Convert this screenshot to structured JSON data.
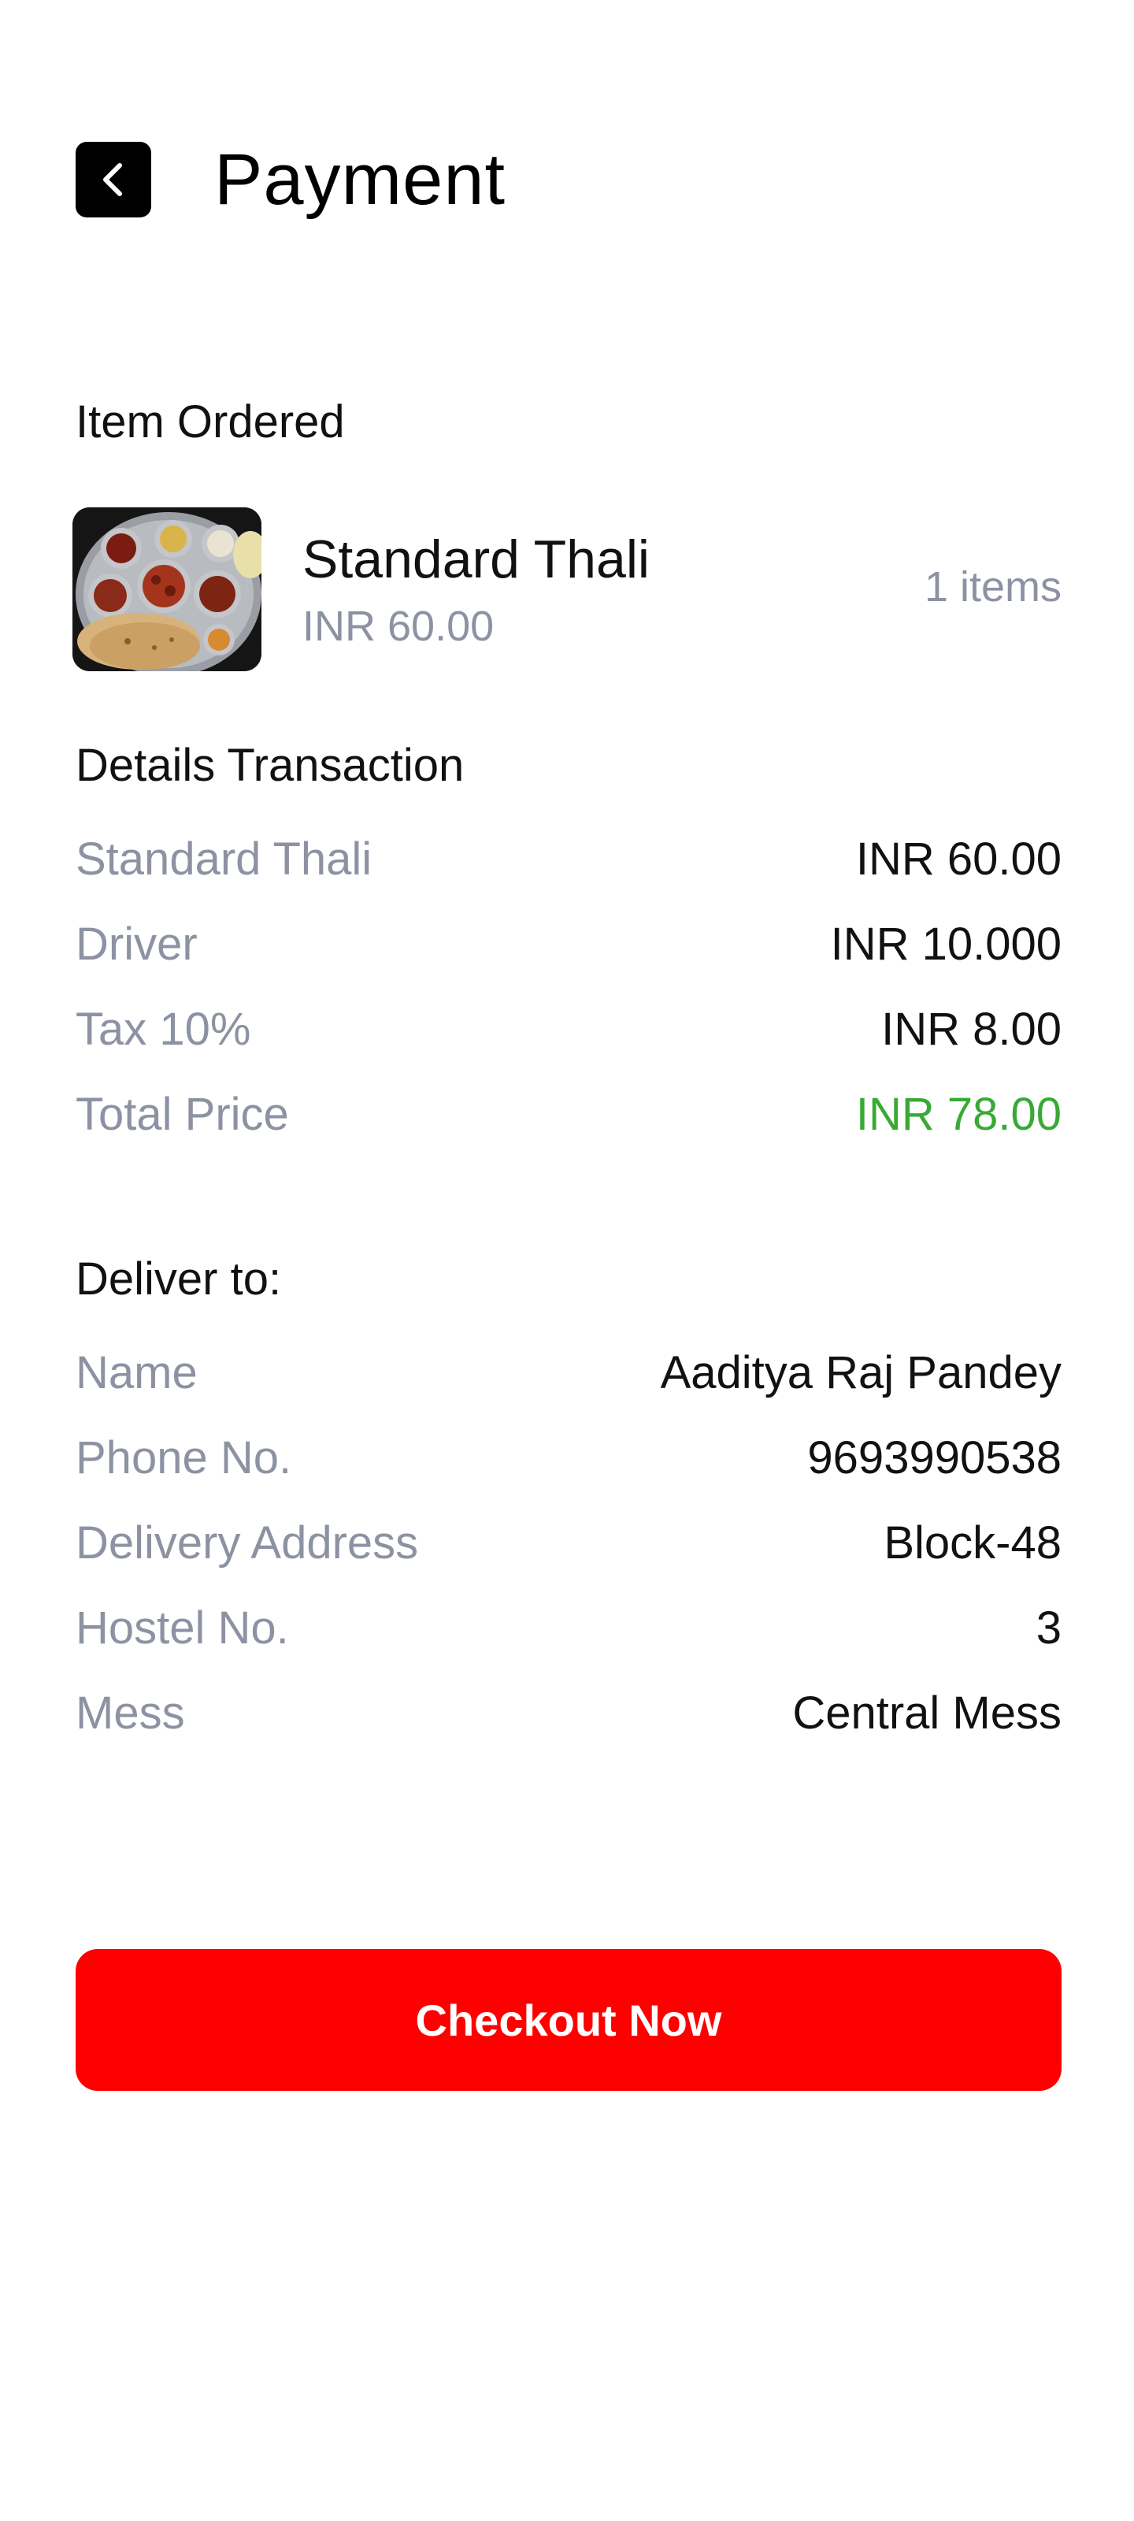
{
  "header": {
    "title": "Payment",
    "back_icon": "chevron-left-icon"
  },
  "item_ordered": {
    "heading": "Item Ordered",
    "name": "Standard Thali",
    "price": "INR 60.00",
    "quantity": "1 items",
    "image_icon": "thali-food-photo"
  },
  "transaction": {
    "heading": "Details Transaction",
    "rows": [
      {
        "label": "Standard Thali",
        "value": "INR 60.00"
      },
      {
        "label": "Driver",
        "value": "INR 10.000"
      },
      {
        "label": "Tax 10%",
        "value": "INR 8.00"
      },
      {
        "label": "Total Price",
        "value": "INR 78.00"
      }
    ]
  },
  "delivery": {
    "heading": "Deliver to:",
    "rows": [
      {
        "label": "Name",
        "value": "Aaditya Raj Pandey"
      },
      {
        "label": "Phone No.",
        "value": "9693990538"
      },
      {
        "label": "Delivery Address",
        "value": "Block-48"
      },
      {
        "label": "Hostel No.",
        "value": "3"
      },
      {
        "label": "Mess",
        "value": "Central Mess"
      }
    ]
  },
  "checkout": {
    "label": "Checkout Now"
  },
  "colors": {
    "accent": "#ff0000",
    "total_green": "#39a935",
    "muted_text": "#8d92a3"
  }
}
